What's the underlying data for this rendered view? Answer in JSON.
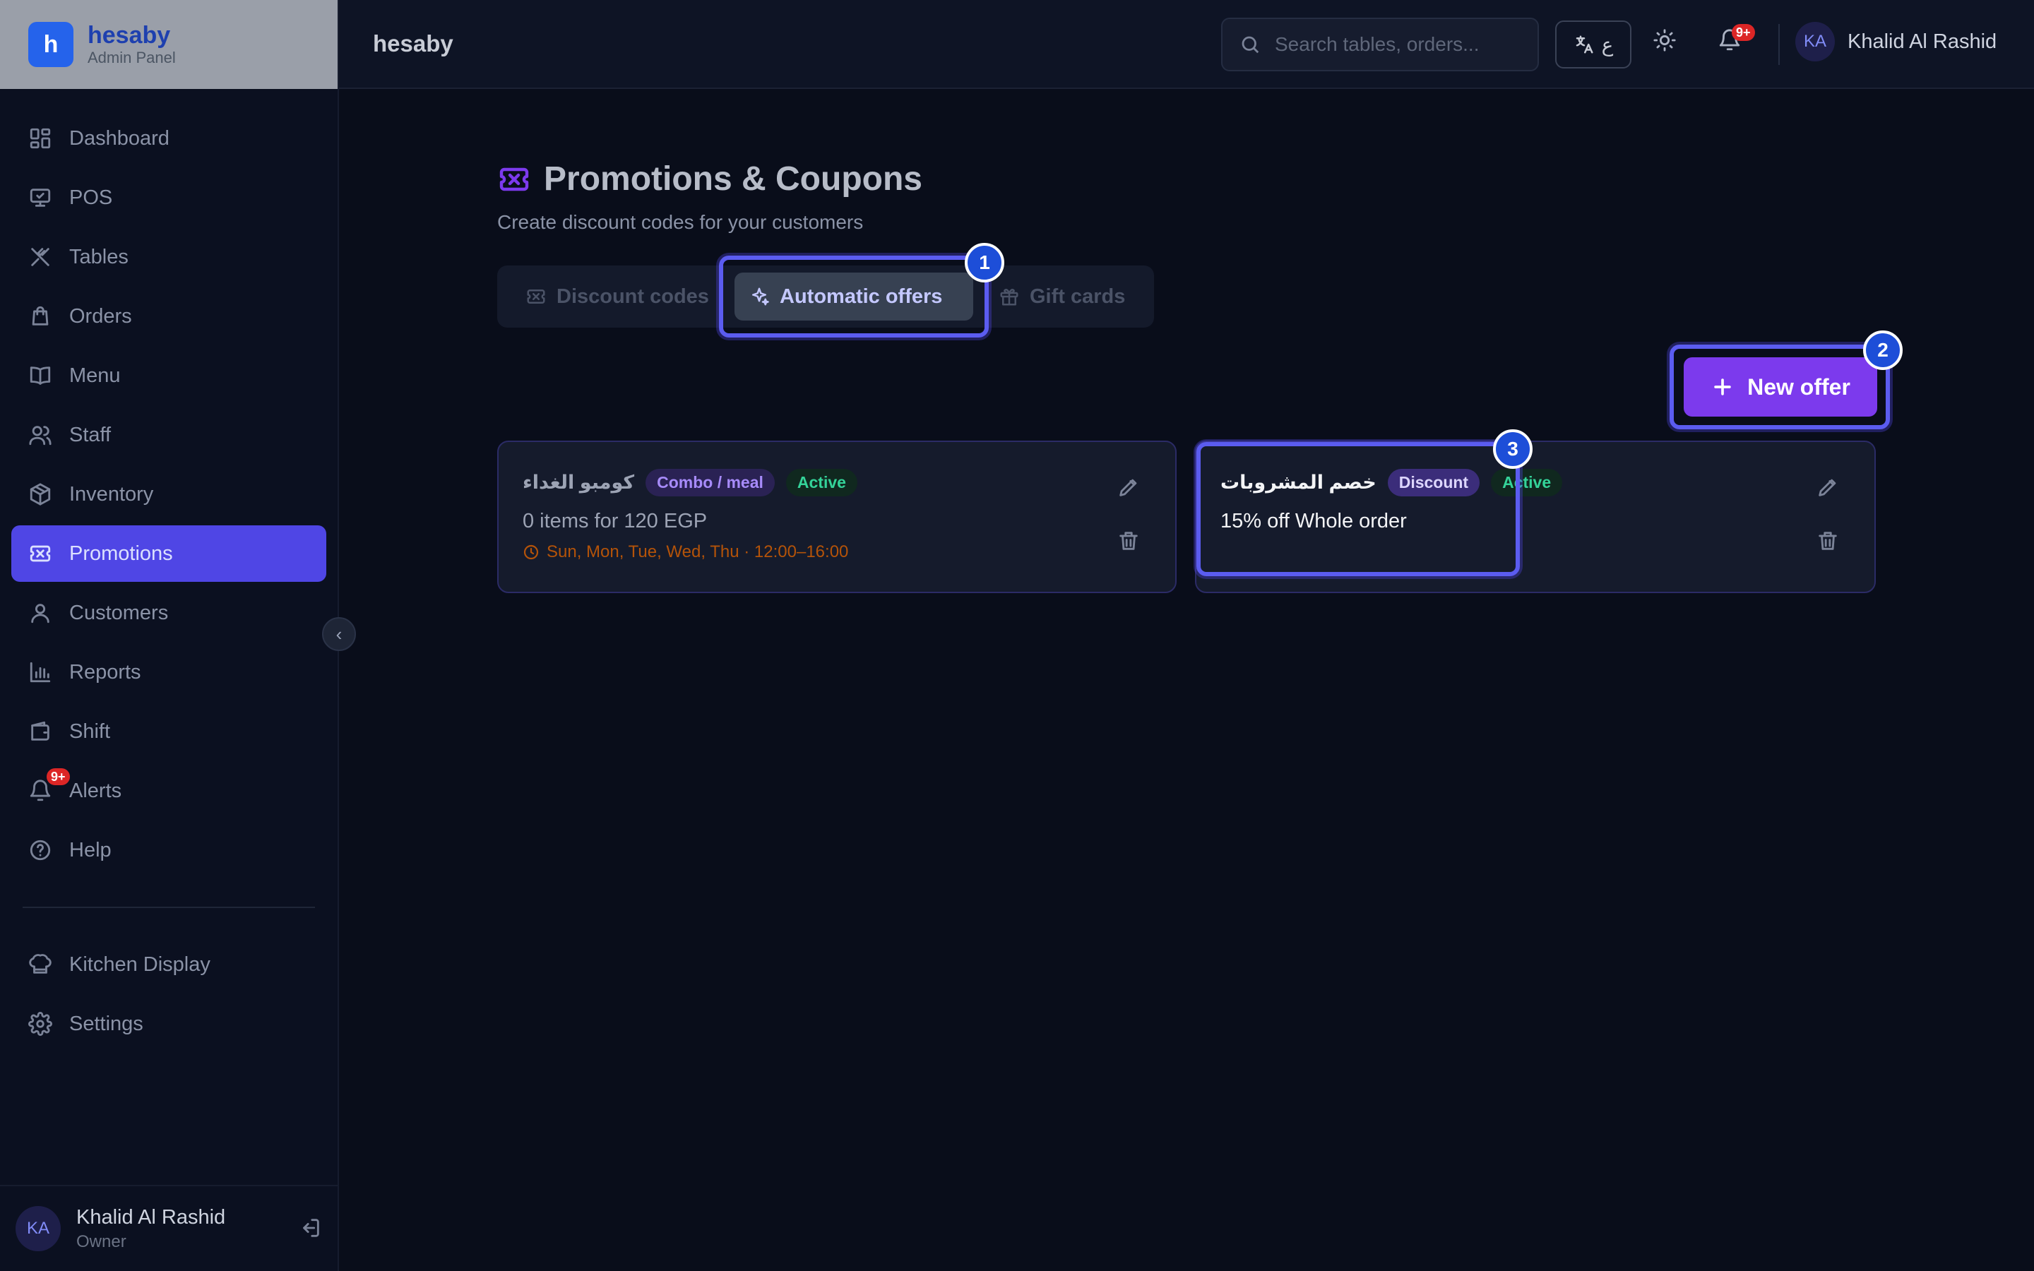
{
  "app": {
    "brand_letter": "h",
    "brand_name": "hesaby",
    "brand_subtitle": "Admin Panel",
    "topbar_title": "hesaby"
  },
  "colors": {
    "accent": "#4f46e5",
    "primary_button": "#7c3aed",
    "highlight": "#5b5cf0",
    "marker": "#1d4ed8",
    "active_badge": "#34d399",
    "schedule": "#b45309",
    "notification": "#dc2626"
  },
  "search": {
    "placeholder": "Search tables, orders..."
  },
  "topbar": {
    "lang_label": "ع",
    "notification_badge": "9+",
    "user_initials": "KA",
    "user_name": "Khalid Al Rashid"
  },
  "sidebar": {
    "items": [
      {
        "label": "Dashboard",
        "icon": "dashboard-icon"
      },
      {
        "label": "POS",
        "icon": "monitor-icon"
      },
      {
        "label": "Tables",
        "icon": "utensils-icon"
      },
      {
        "label": "Orders",
        "icon": "bag-icon"
      },
      {
        "label": "Menu",
        "icon": "book-icon"
      },
      {
        "label": "Staff",
        "icon": "users-icon"
      },
      {
        "label": "Inventory",
        "icon": "box-icon"
      },
      {
        "label": "Promotions",
        "icon": "ticket-icon",
        "active": true
      },
      {
        "label": "Customers",
        "icon": "user-icon"
      },
      {
        "label": "Reports",
        "icon": "bar-chart-icon"
      },
      {
        "label": "Shift",
        "icon": "wallet-icon"
      },
      {
        "label": "Alerts",
        "icon": "bell-icon",
        "badge": "9+"
      },
      {
        "label": "Help",
        "icon": "help-circle-icon"
      },
      {
        "label": "Kitchen Display",
        "icon": "chef-hat-icon"
      },
      {
        "label": "Settings",
        "icon": "gear-icon"
      }
    ],
    "user": {
      "initials": "KA",
      "name": "Khalid Al Rashid",
      "role": "Owner"
    }
  },
  "page": {
    "title": "Promotions & Coupons",
    "subtitle": "Create discount codes for your customers",
    "tabs": [
      {
        "label": "Discount codes",
        "icon": "ticket-icon"
      },
      {
        "label": "Automatic offers",
        "icon": "sparkles-icon",
        "active": true
      },
      {
        "label": "Gift cards",
        "icon": "gift-icon"
      }
    ],
    "new_offer_label": "New offer"
  },
  "markers": [
    "1",
    "2",
    "3"
  ],
  "offers": [
    {
      "name": "كومبو الغداء",
      "type": "Combo / meal",
      "status": "Active",
      "description": "0 items for 120 EGP",
      "schedule": "Sun, Mon, Tue, Wed, Thu · 12:00–16:00"
    },
    {
      "name": "خصم المشروبات",
      "type": "Discount",
      "status": "Active",
      "description": "15% off Whole order"
    }
  ]
}
